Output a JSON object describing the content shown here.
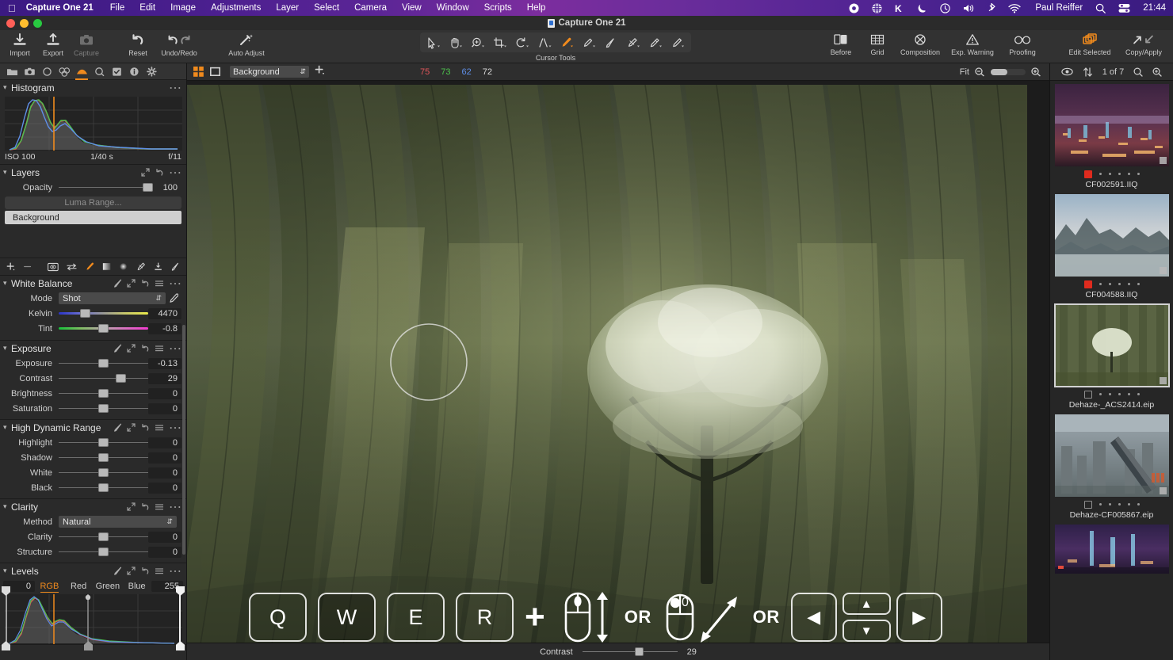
{
  "menubar": {
    "apple_icon": "apple-logo",
    "items": [
      "Capture One 21",
      "File",
      "Edit",
      "Image",
      "Adjustments",
      "Layer",
      "Select",
      "Camera",
      "View",
      "Window",
      "Scripts",
      "Help"
    ],
    "status_icons": [
      "record-icon",
      "globe-icon",
      "k-app-icon",
      "moon-icon",
      "clock-icon",
      "volume-icon",
      "bluetooth-icon",
      "wifi-icon"
    ],
    "user": "Paul Reiffer",
    "search_icon": "search-icon",
    "control-center_icon": "control-center-icon",
    "clock": "21:44"
  },
  "window": {
    "title": "Capture One 21"
  },
  "toolbar": {
    "left": [
      {
        "label": "Import",
        "icon": "import-icon"
      },
      {
        "label": "Export",
        "icon": "export-icon"
      },
      {
        "label": "Capture",
        "icon": "camera-icon"
      },
      {
        "label": "Reset",
        "icon": "reset-icon"
      },
      {
        "label": "Undo/Redo",
        "icon": "undo-redo-icon"
      },
      {
        "label": "Auto Adjust",
        "icon": "auto-adjust-icon"
      }
    ],
    "cursor_tools_label": "Cursor Tools",
    "cursor_tools": [
      "select-arrow-icon",
      "pan-hand-icon",
      "zoom-loupe-icon",
      "crop-icon",
      "rotate-icon",
      "keystone-icon",
      "white-balance-picker-icon",
      "spot-removal-icon",
      "draw-mask-icon",
      "erase-mask-icon",
      "gradient-mask-icon",
      "heal-brush-icon"
    ],
    "right": [
      {
        "label": "Before",
        "icon": "before-after-icon"
      },
      {
        "label": "Grid",
        "icon": "grid-icon"
      },
      {
        "label": "Composition",
        "icon": "composition-icon"
      },
      {
        "label": "Exp. Warning",
        "icon": "exposure-warning-icon"
      },
      {
        "label": "Proofing",
        "icon": "proofing-icon"
      },
      {
        "label": "Edit Selected",
        "icon": "edit-selected-icon"
      },
      {
        "label": "Copy/Apply",
        "icon": "copy-apply-icon"
      }
    ]
  },
  "left_panel": {
    "tabs": [
      "library-icon",
      "capture-icon",
      "lens-icon",
      "color-icon",
      "exposure-icon",
      "details-icon",
      "adjustments-icon",
      "metadata-icon",
      "output-icon"
    ],
    "active_tab_index": 4,
    "histogram": {
      "title": "Histogram",
      "menu_icon": "ellipsis-icon",
      "iso": "ISO 100",
      "shutter": "1/40 s",
      "aperture": "f/11"
    },
    "layers": {
      "title": "Layers",
      "opacity_label": "Opacity",
      "opacity_value": "100",
      "luma_button": "Luma Range...",
      "layer_name": "Background",
      "action_icons": [
        "add-layer-icon",
        "remove-layer-icon",
        "view-mask-icon",
        "invert-mask-icon",
        "draw-mask-icon",
        "linear-gradient-icon",
        "radial-gradient-icon",
        "erase-mask-icon",
        "fill-mask-icon",
        "refine-mask-icon"
      ]
    },
    "white_balance": {
      "title": "White Balance",
      "mode_label": "Mode",
      "mode_value": "Shot",
      "kelvin_label": "Kelvin",
      "kelvin_value": "4470",
      "tint_label": "Tint",
      "tint_value": "-0.8",
      "picker_icon": "eyedropper-icon"
    },
    "exposure": {
      "title": "Exposure",
      "rows": [
        {
          "label": "Exposure",
          "value": "-0.13",
          "pos": 48
        },
        {
          "label": "Contrast",
          "value": "29",
          "pos": 67
        },
        {
          "label": "Brightness",
          "value": "0",
          "pos": 48
        },
        {
          "label": "Saturation",
          "value": "0",
          "pos": 48
        }
      ]
    },
    "hdr": {
      "title": "High Dynamic Range",
      "rows": [
        {
          "label": "Highlight",
          "value": "0",
          "pos": 48
        },
        {
          "label": "Shadow",
          "value": "0",
          "pos": 48
        },
        {
          "label": "White",
          "value": "0",
          "pos": 48
        },
        {
          "label": "Black",
          "value": "0",
          "pos": 48
        }
      ]
    },
    "clarity": {
      "title": "Clarity",
      "method_label": "Method",
      "method_value": "Natural",
      "rows": [
        {
          "label": "Clarity",
          "value": "0",
          "pos": 48
        },
        {
          "label": "Structure",
          "value": "0",
          "pos": 48
        }
      ]
    },
    "levels": {
      "title": "Levels",
      "black_point": "0",
      "white_point": "255",
      "channels": [
        "RGB",
        "Red",
        "Green",
        "Blue"
      ],
      "active_channel": "RGB"
    }
  },
  "viewer": {
    "toolbar": {
      "grid_view_icon": "grid-view-icon",
      "single_view_icon": "single-view-icon",
      "background_select": "Background",
      "add_layer_icon": "add-layer-icon",
      "rgb": {
        "r": "75",
        "g": "73",
        "b": "62",
        "k": "72"
      },
      "fit_label": "Fit",
      "zoom_out_icon": "zoom-out-icon",
      "zoom_in_icon": "zoom-in-icon"
    },
    "status": {
      "label": "Contrast",
      "value": "29"
    },
    "overlay": {
      "keys": [
        "Q",
        "W",
        "E",
        "R"
      ],
      "plus": "+",
      "or_1": "OR",
      "or_2": "OR",
      "mouse_scroll_icon": "mouse-scroll-vertical-icon",
      "mouse_drag_icon": "mouse-drag-diagonal-icon",
      "arrow_left": "◀",
      "arrow_up": "▲",
      "arrow_down": "▼",
      "arrow_right": "▶"
    }
  },
  "browser": {
    "toolbar": {
      "eye_icon": "eye-icon",
      "sort_icon": "sort-icon",
      "counter": "1 of 7",
      "search_icon": "search-icon",
      "zoom_icon": "zoom-icon"
    },
    "thumbnails": [
      {
        "name": "CF002591.IIQ",
        "color_tag": "red",
        "rating": 0,
        "selected": false
      },
      {
        "name": "CF004588.IIQ",
        "color_tag": "red",
        "rating": 0,
        "selected": false
      },
      {
        "name": "Dehaze-_ACS2414.eip",
        "color_tag": "none",
        "rating": 0,
        "selected": true
      },
      {
        "name": "Dehaze-CF005867.eip",
        "color_tag": "none",
        "rating": 0,
        "selected": false
      },
      {
        "name": "",
        "color_tag": "none",
        "rating": 0,
        "selected": false
      }
    ]
  },
  "colors": {
    "accent": "#f08a1d",
    "panel_bg": "#2a2a2a",
    "toolbar_bg": "#323232",
    "tag_red": "#e02b1e"
  }
}
